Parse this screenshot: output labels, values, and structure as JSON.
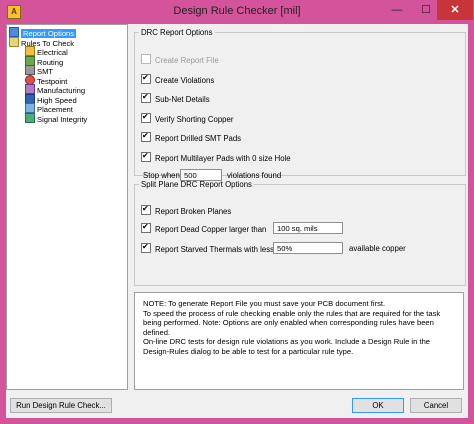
{
  "window": {
    "title": "Design Rule Checker [mil]",
    "minimize_glyph": "—",
    "maximize_glyph": "☐",
    "close_glyph": "✕"
  },
  "tree": {
    "items": [
      {
        "label": "Report Options",
        "icon": "report-options-icon",
        "selected": true
      },
      {
        "label": "Rules To Check",
        "icon": "rules-to-check-icon"
      },
      {
        "label": "Electrical",
        "icon": "electrical-icon"
      },
      {
        "label": "Routing",
        "icon": "routing-icon"
      },
      {
        "label": "SMT",
        "icon": "smt-icon"
      },
      {
        "label": "Testpoint",
        "icon": "testpoint-icon"
      },
      {
        "label": "Manufacturing",
        "icon": "manufacturing-icon"
      },
      {
        "label": "High Speed",
        "icon": "high-speed-icon"
      },
      {
        "label": "Placement",
        "icon": "placement-icon"
      },
      {
        "label": "Signal Integrity",
        "icon": "signal-integrity-icon"
      }
    ]
  },
  "drc": {
    "legend": "DRC Report Options",
    "create_report_file": "Create Report File",
    "create_violations": "Create Violations",
    "sub_net_details": "Sub-Net Details",
    "verify_shorting_copper": "Verify Shorting Copper",
    "report_drilled_smt_pads": "Report Drilled SMT Pads",
    "report_multilayer_pads": "Report Multilayer Pads with 0 size Hole",
    "stop_when": "Stop when",
    "stop_value": "500",
    "violations_found": "violations found"
  },
  "split": {
    "legend": "Split Plane DRC Report Options",
    "report_broken_planes": "Report Broken Planes",
    "report_dead_copper": "Report Dead Copper larger than",
    "dead_copper_value": "100 sq. mils",
    "report_starved_thermals": "Report Starved Thermals with less than",
    "starved_value": "50%",
    "available_copper": "available copper"
  },
  "note": {
    "text": "NOTE: To generate Report File you must save your PCB document first.\nTo speed the process of rule checking enable only the rules that are required for the task being performed.  Note: Options are only enabled when corresponding rules have been defined.\nOn-line DRC tests for design rule violations as you work. Include a Design Rule in the Design-Rules dialog to be able to test for a particular rule  type."
  },
  "buttons": {
    "run_drc": "Run Design Rule Check...",
    "ok": "OK",
    "cancel": "Cancel"
  },
  "colors": {
    "frame": "#d4549b",
    "close": "#c7353a",
    "selection": "#3399ff"
  }
}
